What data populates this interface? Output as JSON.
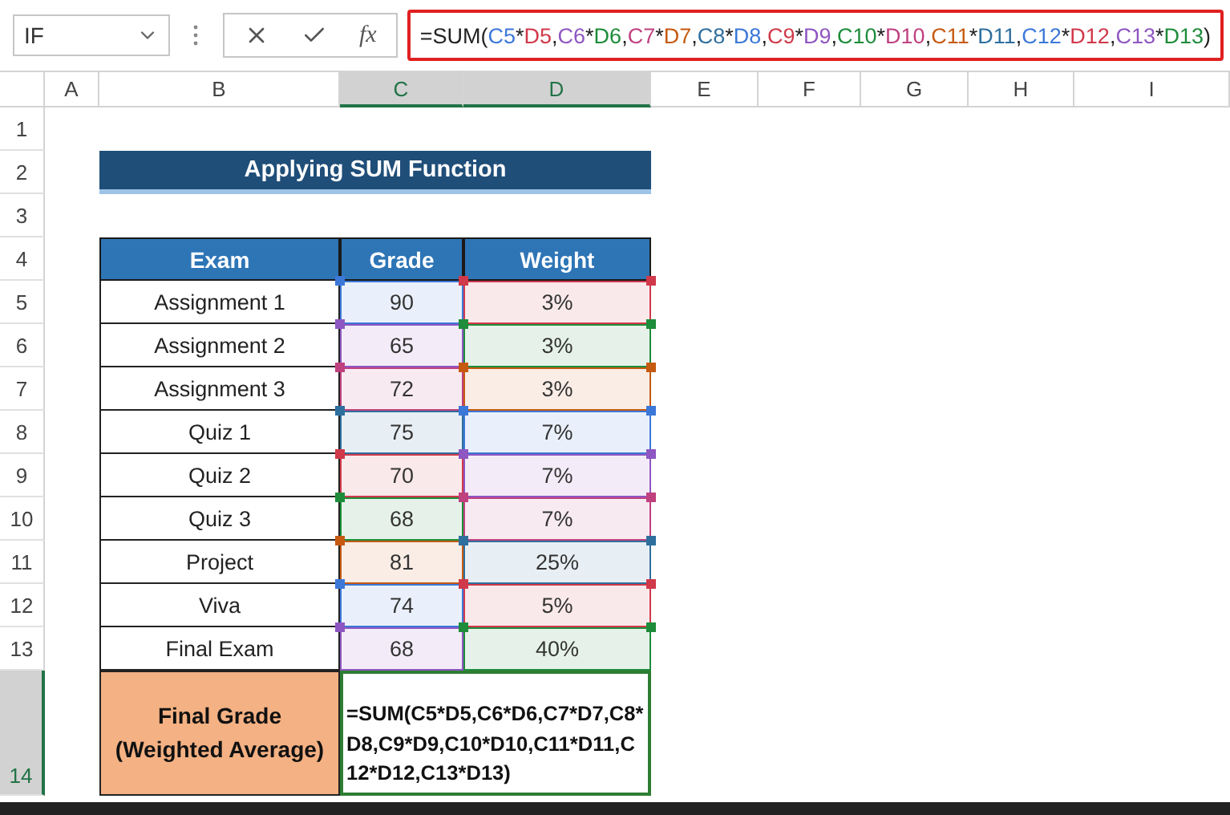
{
  "formula_bar": {
    "name_box": "IF",
    "function_label": "fx",
    "formula": [
      {
        "text": "=SUM("
      },
      {
        "text": "C5",
        "color": "#3c78d8"
      },
      {
        "text": "*"
      },
      {
        "text": "D5",
        "color": "#d0394a"
      },
      {
        "text": ","
      },
      {
        "text": "C6",
        "color": "#8e56c1"
      },
      {
        "text": "*"
      },
      {
        "text": "D6",
        "color": "#1e8c3a"
      },
      {
        "text": ","
      },
      {
        "text": "C7",
        "color": "#c0417f"
      },
      {
        "text": "*"
      },
      {
        "text": "D7",
        "color": "#c55a11"
      },
      {
        "text": ","
      },
      {
        "text": "C8",
        "color": "#2e6f9e"
      },
      {
        "text": "*"
      },
      {
        "text": "D8",
        "color": "#3c78d8"
      },
      {
        "text": ","
      },
      {
        "text": "C9",
        "color": "#d0394a"
      },
      {
        "text": "*"
      },
      {
        "text": "D9",
        "color": "#8e56c1"
      },
      {
        "text": ","
      },
      {
        "text": "C10",
        "color": "#1e8c3a"
      },
      {
        "text": "*"
      },
      {
        "text": "D10",
        "color": "#c0417f"
      },
      {
        "text": ","
      },
      {
        "text": "C11",
        "color": "#c55a11"
      },
      {
        "text": "*"
      },
      {
        "text": "D11",
        "color": "#2e6f9e"
      },
      {
        "text": ","
      },
      {
        "text": "C12",
        "color": "#3c78d8"
      },
      {
        "text": "*"
      },
      {
        "text": "D12",
        "color": "#d0394a"
      },
      {
        "text": ","
      },
      {
        "text": "C13",
        "color": "#8e56c1"
      },
      {
        "text": "*"
      },
      {
        "text": "D13",
        "color": "#1e8c3a"
      },
      {
        "text": ")"
      }
    ]
  },
  "columns": [
    {
      "label": "A",
      "selected": false
    },
    {
      "label": "B",
      "selected": false
    },
    {
      "label": "C",
      "selected": true
    },
    {
      "label": "D",
      "selected": true
    },
    {
      "label": "E",
      "selected": false
    },
    {
      "label": "F",
      "selected": false
    },
    {
      "label": "G",
      "selected": false
    },
    {
      "label": "H",
      "selected": false
    },
    {
      "label": "I",
      "selected": false
    }
  ],
  "row_numbers": [
    {
      "label": "1",
      "selected": false
    },
    {
      "label": "2",
      "selected": false
    },
    {
      "label": "3",
      "selected": false
    },
    {
      "label": "4",
      "selected": false
    },
    {
      "label": "5",
      "selected": false
    },
    {
      "label": "6",
      "selected": false
    },
    {
      "label": "7",
      "selected": false
    },
    {
      "label": "8",
      "selected": false
    },
    {
      "label": "9",
      "selected": false
    },
    {
      "label": "10",
      "selected": false
    },
    {
      "label": "11",
      "selected": false
    },
    {
      "label": "12",
      "selected": false
    },
    {
      "label": "13",
      "selected": false
    },
    {
      "label": "14",
      "selected": true
    }
  ],
  "title": "Applying SUM Function",
  "table": {
    "headers": [
      "Exam",
      "Grade",
      "Weight"
    ],
    "rows": [
      {
        "exam": "Assignment 1",
        "grade": {
          "text": "90",
          "color": "#3c78d8"
        },
        "weight": {
          "text": "3%",
          "color": "#d0394a"
        }
      },
      {
        "exam": "Assignment 2",
        "grade": {
          "text": "65",
          "color": "#8e56c1"
        },
        "weight": {
          "text": "3%",
          "color": "#1e8c3a"
        }
      },
      {
        "exam": "Assignment 3",
        "grade": {
          "text": "72",
          "color": "#c0417f"
        },
        "weight": {
          "text": "3%",
          "color": "#c55a11"
        }
      },
      {
        "exam": "Quiz 1",
        "grade": {
          "text": "75",
          "color": "#2e6f9e"
        },
        "weight": {
          "text": "7%",
          "color": "#3c78d8"
        }
      },
      {
        "exam": "Quiz 2",
        "grade": {
          "text": "70",
          "color": "#d0394a"
        },
        "weight": {
          "text": "7%",
          "color": "#8e56c1"
        }
      },
      {
        "exam": "Quiz 3",
        "grade": {
          "text": "68",
          "color": "#1e8c3a"
        },
        "weight": {
          "text": "7%",
          "color": "#c0417f"
        }
      },
      {
        "exam": "Project",
        "grade": {
          "text": "81",
          "color": "#c55a11"
        },
        "weight": {
          "text": "25%",
          "color": "#2e6f9e"
        }
      },
      {
        "exam": "Viva",
        "grade": {
          "text": "74",
          "color": "#3c78d8"
        },
        "weight": {
          "text": "5%",
          "color": "#d0394a"
        }
      },
      {
        "exam": "Final Exam",
        "grade": {
          "text": "68",
          "color": "#8e56c1"
        },
        "weight": {
          "text": "40%",
          "color": "#1e8c3a"
        }
      }
    ],
    "result_label": "Final Grade (Weighted Average)",
    "result_formula": "=SUM(C5*D5,C6*D6,C7*D7,C8*D8,C9*D9,C10*D10,C11*D11,C12*D12,C13*D13)"
  }
}
